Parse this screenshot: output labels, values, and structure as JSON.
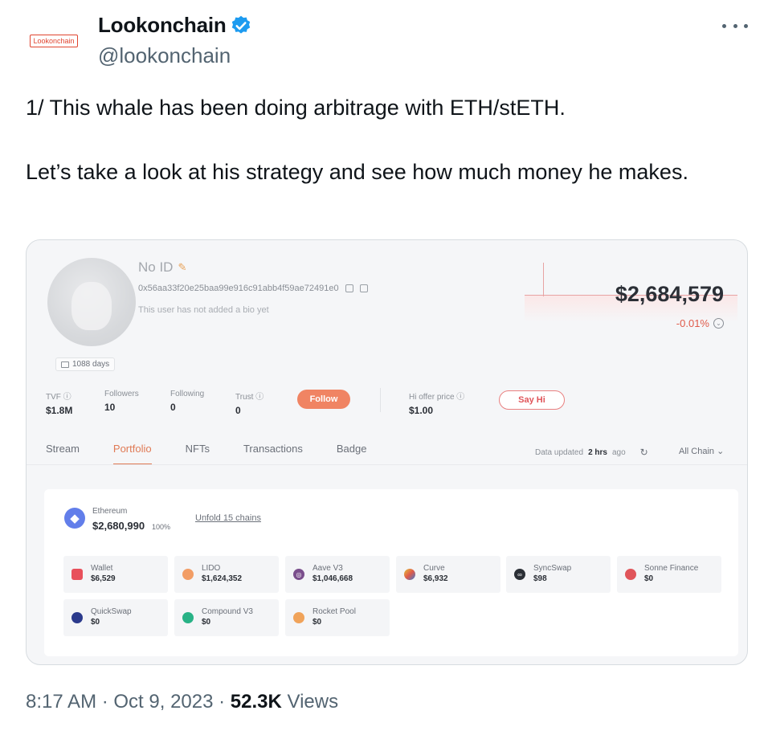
{
  "tweet": {
    "author_name": "Lookonchain",
    "author_handle": "@lookonchain",
    "avatar_text": "Lookonchain",
    "text_line1": "1/ This whale has been doing arbitrage with ETH/stETH.",
    "text_line2": "Let’s take a look at his strategy and see how much money he makes.",
    "time": "8:17 AM",
    "date": "Oct 9, 2023",
    "views_count": "52.3K",
    "views_label": "Views",
    "verified_color": "#1d9bf0"
  },
  "profile": {
    "name": "No ID",
    "address": "0x56aa33f20e25baa99e916c91abb4f59ae72491e0",
    "bio": "This user has not added a bio yet",
    "days": "1088 days",
    "balance": "$2,684,579",
    "change": "-0.01%",
    "stats": [
      {
        "label": "TVF",
        "value": "$1.8M"
      },
      {
        "label": "Followers",
        "value": "10"
      },
      {
        "label": "Following",
        "value": "0"
      },
      {
        "label": "Trust",
        "value": "0"
      }
    ],
    "follow_label": "Follow",
    "hi_offer_label": "Hi offer price",
    "hi_offer_value": "$1.00",
    "say_hi_label": "Say Hi",
    "tabs": [
      "Stream",
      "Portfolio",
      "NFTs",
      "Transactions",
      "Badge"
    ],
    "active_tab": "Portfolio",
    "updated_prefix": "Data updated",
    "updated_value": "2 hrs",
    "updated_suffix": "ago",
    "all_chain_label": "All Chain"
  },
  "portfolio": {
    "chain_name": "Ethereum",
    "chain_value": "$2,680,990",
    "chain_pct": "100%",
    "unfold_label": "Unfold 15 chains",
    "protocols": [
      {
        "name": "Wallet",
        "value": "$6,529",
        "color": "#e8505b",
        "icon": "wallet-icon"
      },
      {
        "name": "LIDO",
        "value": "$1,624,352",
        "color": "#f29d65",
        "icon": "lido-icon"
      },
      {
        "name": "Aave V3",
        "value": "$1,046,668",
        "color": "#7a4e8c",
        "icon": "aave-icon"
      },
      {
        "name": "Curve",
        "value": "$6,932",
        "color": "#e4c23a",
        "icon": "curve-icon"
      },
      {
        "name": "SyncSwap",
        "value": "$98",
        "color": "#2b2f36",
        "icon": "syncswap-icon"
      },
      {
        "name": "Sonne Finance",
        "value": "$0",
        "color": "#e0555a",
        "icon": "sonne-icon"
      },
      {
        "name": "QuickSwap",
        "value": "$0",
        "color": "#2b3a8c",
        "icon": "quickswap-icon"
      },
      {
        "name": "Compound V3",
        "value": "$0",
        "color": "#28b286",
        "icon": "compound-icon"
      },
      {
        "name": "Rocket Pool",
        "value": "$0",
        "color": "#f0a35a",
        "icon": "rocketpool-icon"
      }
    ]
  }
}
